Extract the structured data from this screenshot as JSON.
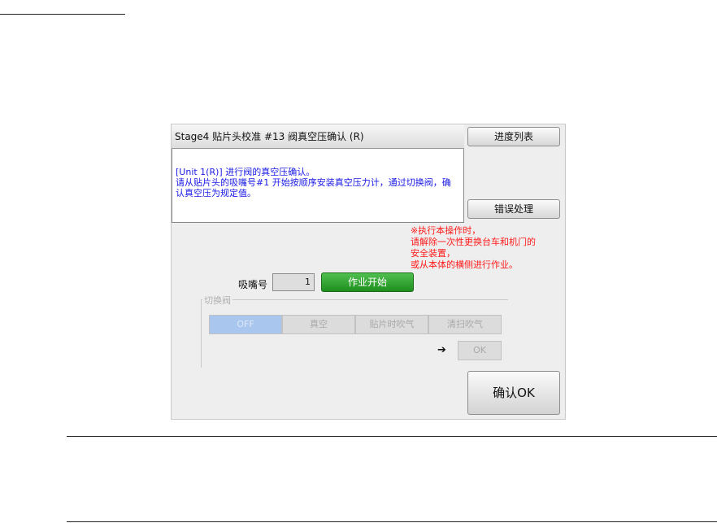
{
  "dialog": {
    "title": "Stage4 贴片头校准 #13 阀真空压确认 (R)",
    "message": [
      "[Unit 1(R)] 进行阀的真空压确认。",
      "请从贴片头的吸嘴号#1 开始按顺序安装真空压力计，通过切换阀，确",
      "认真空压为规定值。"
    ],
    "progress_button": "进度列表",
    "error_button": "错误处理",
    "warning": [
      "※执行本操作时，",
      "请解除一次性更换台车和机门的",
      "安全装置，",
      "或从本体的横侧进行作业。"
    ],
    "nozzle_label": "吸嘴号",
    "nozzle_value": "1",
    "start_button": "作业开始",
    "valve_group_label": "切换阀",
    "valve_options": [
      "OFF",
      "真空",
      "贴片时吹气",
      "清扫吹气"
    ],
    "valve_selected": "OFF",
    "arrow_icon": "arrow-right-icon",
    "ok_button": "OK",
    "confirm_button": "确认OK"
  },
  "colors": {
    "message_text": "#1a1ae6",
    "warning_text": "#ff1a1a",
    "start_button": "#2a9a2a",
    "selected_segment": "#a9c6ef"
  }
}
